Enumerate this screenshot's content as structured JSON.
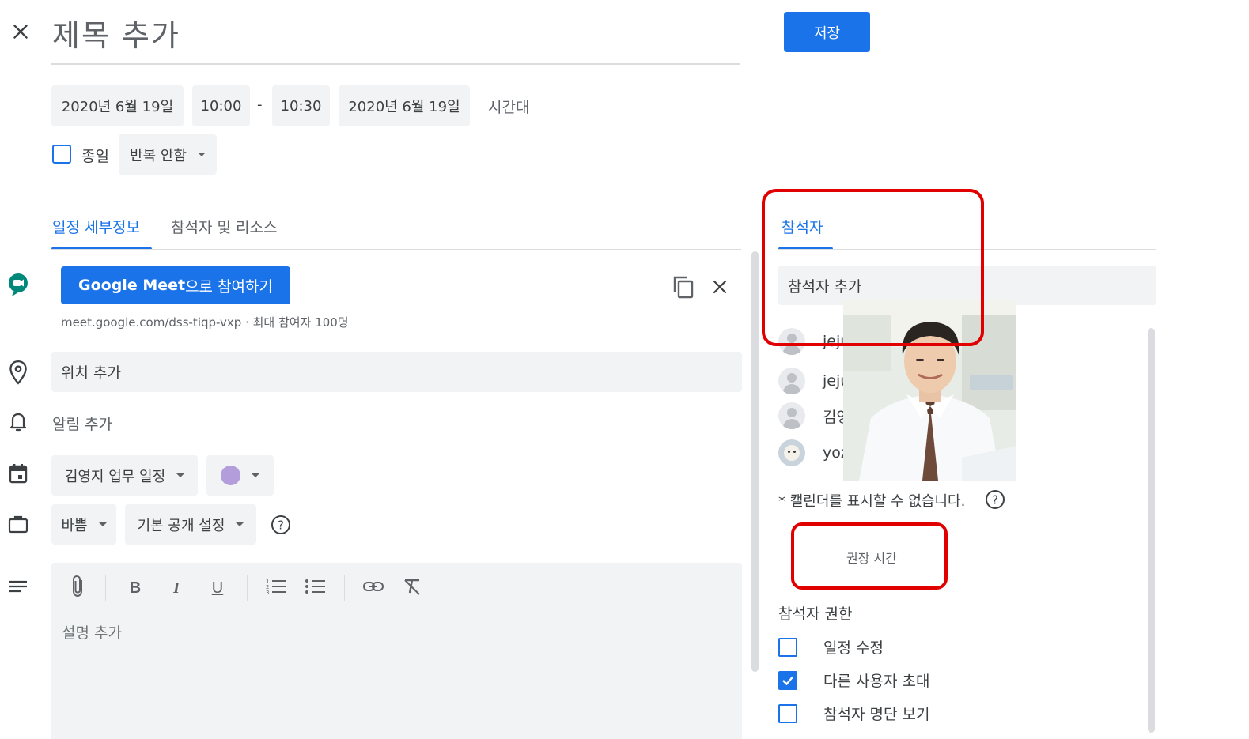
{
  "header": {
    "title_placeholder": "제목 추가",
    "save_label": "저장"
  },
  "datetime": {
    "start_date": "2020년 6월 19일",
    "start_time": "10:00",
    "separator": "-",
    "end_time": "10:30",
    "end_date": "2020년 6월 19일",
    "timezone_label": "시간대",
    "all_day_label": "종일",
    "all_day_checked": false,
    "repeat_label": "반복 안함"
  },
  "tabs": [
    {
      "label": "일정 세부정보",
      "active": true
    },
    {
      "label": "참석자 및 리소스",
      "active": false
    }
  ],
  "meet": {
    "button_bold": "Google Meet",
    "button_rest": "으로 참여하기",
    "link_text": "meet.google.com/dss-tiqp-vxp · 최대 참여자 100명"
  },
  "details": {
    "location_placeholder": "위치 추가",
    "notification_label": "알림 추가",
    "calendar_name": "김영지 업무 일정",
    "event_color": "#b39ddb",
    "busy_label": "바쁨",
    "visibility_label": "기본 공개 설정",
    "description_placeholder": "설명 추가"
  },
  "guests_panel": {
    "tab_label": "참석자",
    "add_guests_placeholder": "참석자 추가",
    "guests": [
      {
        "name": "jeju"
      },
      {
        "name": "jeju"
      },
      {
        "name": "김영"
      },
      {
        "name": "yoz"
      }
    ],
    "calendar_notice": "* 캘린더를 표시할 수 없습니다.",
    "suggested_times_label": "권장 시간",
    "permissions_title": "참석자 권한",
    "permissions": [
      {
        "label": "일정 수정",
        "checked": false
      },
      {
        "label": "다른 사용자 초대",
        "checked": true
      },
      {
        "label": "참석자 명단 보기",
        "checked": false
      }
    ]
  },
  "colors": {
    "accent": "#1a73e8",
    "highlight": "#e00000",
    "meet_green": "#00897b"
  }
}
